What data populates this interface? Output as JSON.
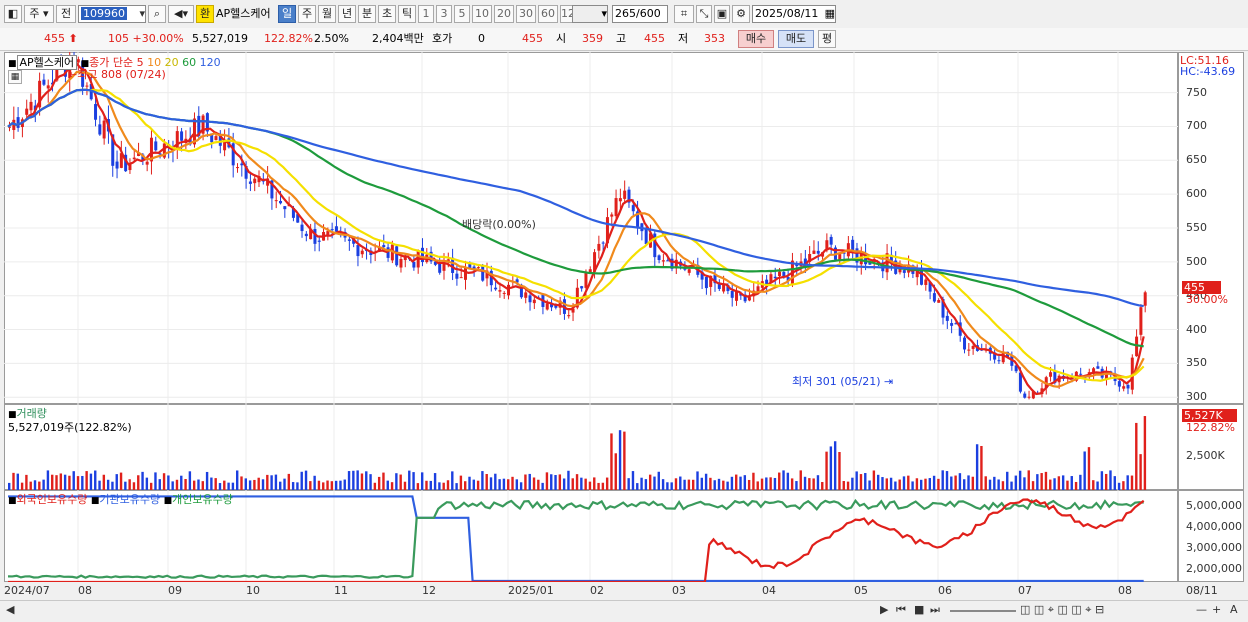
{
  "toolbar": {
    "period_type": "주",
    "prev_label": "전",
    "stock_code": "109960",
    "exchange_badge": "환",
    "stock_name": "AP헬스케어",
    "period_tabs": [
      "일",
      "주",
      "월",
      "년",
      "분",
      "초",
      "틱"
    ],
    "active_tab": "일",
    "interval_buttons": [
      "1",
      "3",
      "5",
      "10",
      "20",
      "30",
      "60",
      "120"
    ],
    "count_value": "265",
    "count_total": "/600",
    "date_value": "2025/08/11"
  },
  "quote": {
    "price": "455",
    "change": "105",
    "change_pct": "+30.00%",
    "volume": "5,527,019",
    "volume_ratio": "122.82%",
    "turnover": "2.50%",
    "amount": "2,404백만",
    "hoga_label": "호가",
    "hoga_value": "0",
    "hoga_price": "455",
    "open_label": "시",
    "open": "359",
    "high_label": "고",
    "high": "455",
    "low_label": "저",
    "low": "353",
    "buy_label": "매수",
    "sell_label": "매도",
    "eval_label": "평"
  },
  "price_panel": {
    "stock_label": "AP헬스케어",
    "ma_title": "종가 단순",
    "ma_periods": [
      "5",
      "10",
      "20",
      "60",
      "120"
    ],
    "ma_colors": [
      "#e0201b",
      "#f08a1c",
      "#f5e000",
      "#1e9b3c",
      "#2f5fe0"
    ],
    "high_annotation": "최고 808 (07/24)",
    "low_annotation": "최저 301 (05/21)",
    "dividend_annotation": "배당락(0.00%)",
    "lc_label": "LC:51.16",
    "hc_label": "HC:-43.69",
    "current_price_tag": "455",
    "current_pct_tag": "30.00%",
    "y_ticks": [
      "750",
      "700",
      "650",
      "600",
      "550",
      "500",
      "450",
      "400",
      "350",
      "300"
    ]
  },
  "volume_panel": {
    "title": "거래량",
    "value": "5,527,019주(122.82%)",
    "current_tag": "5,527K",
    "current_pct": "122.82%",
    "y_ticks": [
      "2,500K"
    ]
  },
  "holding_panel": {
    "legend": [
      "외국인보유수량",
      "기관보유수량",
      "개인보유수량"
    ],
    "legend_colors": [
      "#e0201b",
      "#2f5fe0",
      "#1e9b3c"
    ],
    "y_ticks": [
      "5,000,000",
      "4,000,000",
      "3,000,000",
      "2,000,000"
    ]
  },
  "x_axis": {
    "ticks": [
      "2024/07",
      "08",
      "09",
      "10",
      "11",
      "12",
      "2025/01",
      "02",
      "03",
      "04",
      "05",
      "06",
      "07",
      "08"
    ],
    "end_label": "08/11"
  },
  "chart_data": {
    "type": "candlestick",
    "x_range": [
      "2024/07",
      "2025/08/11"
    ],
    "ylim": [
      290,
      810
    ],
    "close_trend": [
      {
        "x": "2024/07",
        "y": 700
      },
      {
        "x": "2024/07/24",
        "y": 808
      },
      {
        "x": "2024/08",
        "y": 640
      },
      {
        "x": "2024/09",
        "y": 700
      },
      {
        "x": "2024/09/20",
        "y": 620
      },
      {
        "x": "2024/10",
        "y": 540
      },
      {
        "x": "2024/11",
        "y": 480
      },
      {
        "x": "2024/12",
        "y": 430
      },
      {
        "x": "2024/12/20",
        "y": 600
      },
      {
        "x": "2025/01",
        "y": 520
      },
      {
        "x": "2025/02",
        "y": 440
      },
      {
        "x": "2025/03",
        "y": 520
      },
      {
        "x": "2025/04",
        "y": 490
      },
      {
        "x": "2025/04/15",
        "y": 380
      },
      {
        "x": "2025/05",
        "y": 360
      },
      {
        "x": "2025/05/21",
        "y": 301
      },
      {
        "x": "2025/06",
        "y": 330
      },
      {
        "x": "2025/07",
        "y": 335
      },
      {
        "x": "2025/08",
        "y": 320
      },
      {
        "x": "2025/08/11",
        "y": 455
      }
    ],
    "ma120_trend": [
      {
        "x": "2024/07",
        "y": 638
      },
      {
        "x": "2024/09",
        "y": 680
      },
      {
        "x": "2024/11",
        "y": 630
      },
      {
        "x": "2025/01",
        "y": 595
      },
      {
        "x": "2025/03",
        "y": 530
      },
      {
        "x": "2025/05",
        "y": 470
      },
      {
        "x": "2025/07",
        "y": 420
      },
      {
        "x": "2025/08/11",
        "y": 385
      }
    ]
  }
}
